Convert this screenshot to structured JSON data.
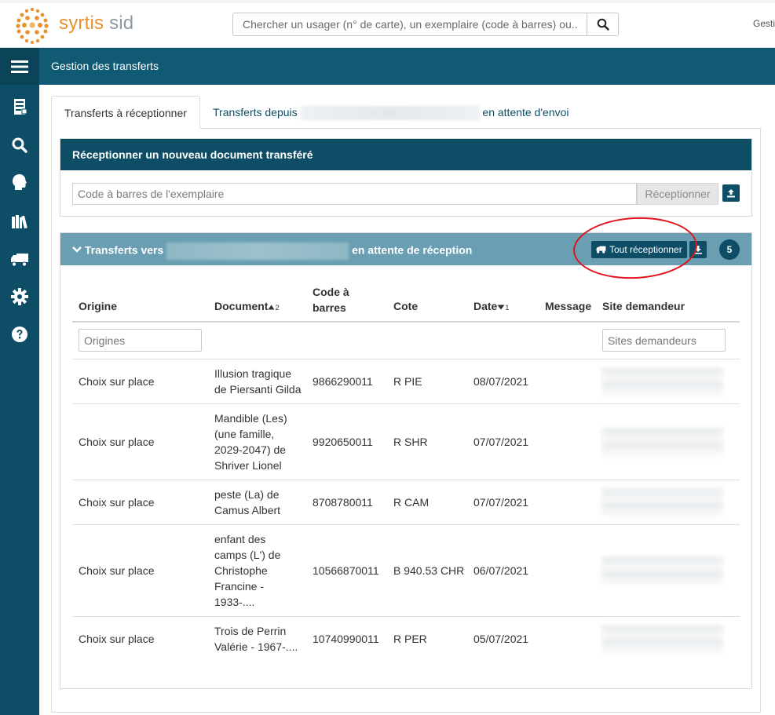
{
  "brand": {
    "name": "syrtis",
    "suffix": "sid"
  },
  "search": {
    "placeholder": "Chercher un usager (n° de carte), un exemplaire (code à barres) ou..."
  },
  "header": {
    "right_label": "Gestio"
  },
  "page": {
    "title": "Gestion des transferts"
  },
  "tabs": [
    {
      "label": "Transferts à réceptionner"
    },
    {
      "label_before": "Transferts depuis",
      "label_after": "en attente d'envoi"
    }
  ],
  "receive_panel": {
    "title": "Réceptionner un nouveau document transféré",
    "barcode_placeholder": "Code à barres de l'exemplaire",
    "receive_label": "Réceptionner"
  },
  "transfers_panel": {
    "title_before": "Transferts vers",
    "title_after": "en attente de réception",
    "receive_all_label": "Tout réceptionner",
    "count": "5"
  },
  "table": {
    "headers": {
      "origin": "Origine",
      "document": "Document",
      "document_sort": "2",
      "barcode_l1": "Code à",
      "barcode_l2": "barres",
      "shelfmark": "Cote",
      "date": "Date",
      "date_sort": "1",
      "message": "Message",
      "site": "Site demandeur"
    },
    "filters": {
      "origins_placeholder": "Origines",
      "sites_placeholder": "Sites demandeurs"
    },
    "rows": [
      {
        "origin": "Choix sur place",
        "document": [
          "Illusion tragique",
          "de Piersanti Gilda"
        ],
        "barcode": "9866290011",
        "shelfmark": "R PIE",
        "date": "08/07/2021"
      },
      {
        "origin": "Choix sur place",
        "document": [
          "Mandible (Les)",
          "(une famille,",
          "2029-2047) de",
          "Shriver Lionel"
        ],
        "barcode": "9920650011",
        "shelfmark": "R SHR",
        "date": "07/07/2021"
      },
      {
        "origin": "Choix sur place",
        "document": [
          "peste (La) de",
          "Camus Albert"
        ],
        "barcode": "8708780011",
        "shelfmark": "R CAM",
        "date": "07/07/2021"
      },
      {
        "origin": "Choix sur place",
        "document": [
          "enfant des",
          "camps (L') de",
          "Christophe",
          "Francine -",
          "1933-...."
        ],
        "barcode": "10566870011",
        "shelfmark": "B 940.53 CHR",
        "date": "06/07/2021"
      },
      {
        "origin": "Choix sur place",
        "document": [
          "Trois de Perrin",
          "Valérie - 1967-...."
        ],
        "barcode": "10740990011",
        "shelfmark": "R PER",
        "date": "05/07/2021"
      }
    ]
  },
  "colors": {
    "primary": "#0d4d66",
    "title_bar": "#105a73",
    "panel_head": "#6a9fb3",
    "brand_orange": "#e8912f",
    "annotation_red": "#e0141b"
  }
}
